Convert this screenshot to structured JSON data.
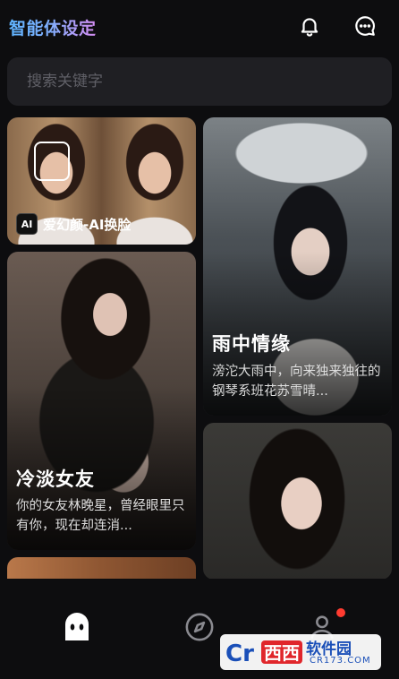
{
  "header": {
    "title": "智能体设定",
    "icons": [
      "bell-icon",
      "message-icon"
    ]
  },
  "search": {
    "placeholder": "搜索关键字"
  },
  "cards": [
    {
      "id": "ad",
      "badge_logo": "AI",
      "badge_text": "爱幻颜-AI换脸"
    },
    {
      "id": "rain",
      "title": "雨中情缘",
      "desc": "滂沱大雨中，向来独来独往的钢琴系班花苏雪晴..."
    },
    {
      "id": "cold",
      "title": "冷淡女友",
      "desc": "你的女友林晚星，曾经眼里只有你，现在却连消..."
    },
    {
      "id": "portrait"
    },
    {
      "id": "partial"
    }
  ],
  "bottom_nav": {
    "items": [
      "home-ghost-icon",
      "compass-icon",
      "profile-icon"
    ],
    "notification_dot_color": "#ff3b30"
  },
  "watermark": {
    "brand": "西西",
    "text": "软件园",
    "url": "CR173.COM"
  }
}
